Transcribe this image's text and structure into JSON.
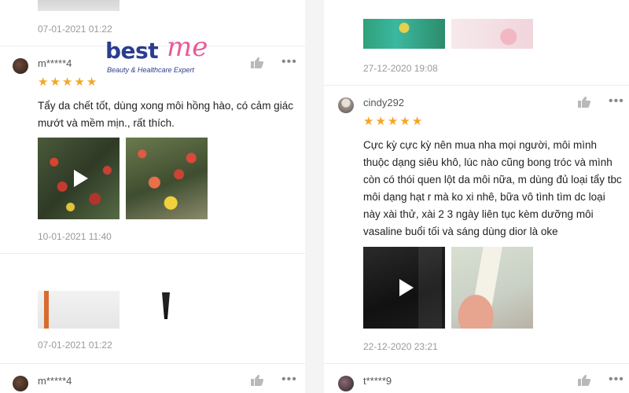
{
  "brand": {
    "name_part1": "best",
    "name_part2": "me",
    "tagline": "Beauty & Healthcare Expert",
    "color_primary": "#2b3d8f",
    "color_accent": "#e85a9a"
  },
  "icons": {
    "like": "thumbs-up-icon",
    "more": "more-options-icon",
    "play": "play-icon",
    "star": "star-icon"
  },
  "left_column": {
    "top_date": "07-01-2021 01:22",
    "review1": {
      "username": "m*****4",
      "rating": 5,
      "text": "Tẩy da chết tốt, dùng xong môi hồng hào, có cảm giác mướt và mềm mịn., rất thích.",
      "date": "10-01-2021 11:40"
    },
    "review2": {
      "date": "07-01-2021 01:22"
    },
    "review3": {
      "username": "m*****4"
    }
  },
  "right_column": {
    "top_date": "27-12-2020 19:08",
    "review1": {
      "username": "cindy292",
      "rating": 5,
      "text": "Cực kỳ cực kỳ nên mua nha mọi người, môi mình thuộc dạng siêu khô, lúc nào cũng bong tróc và mình còn có thói quen lột da môi nữa, m dùng đủ loại tẩy tbc môi dạng hạt r mà ko xi nhê, bữa vô tình tìm dc loại này xài thử, xài 2 3 ngày liên tục kèm dưỡng môi vasaline buổi tối và sáng dùng dior là oke",
      "date": "22-12-2020 23:21"
    },
    "review2": {
      "username": "t*****9"
    }
  }
}
